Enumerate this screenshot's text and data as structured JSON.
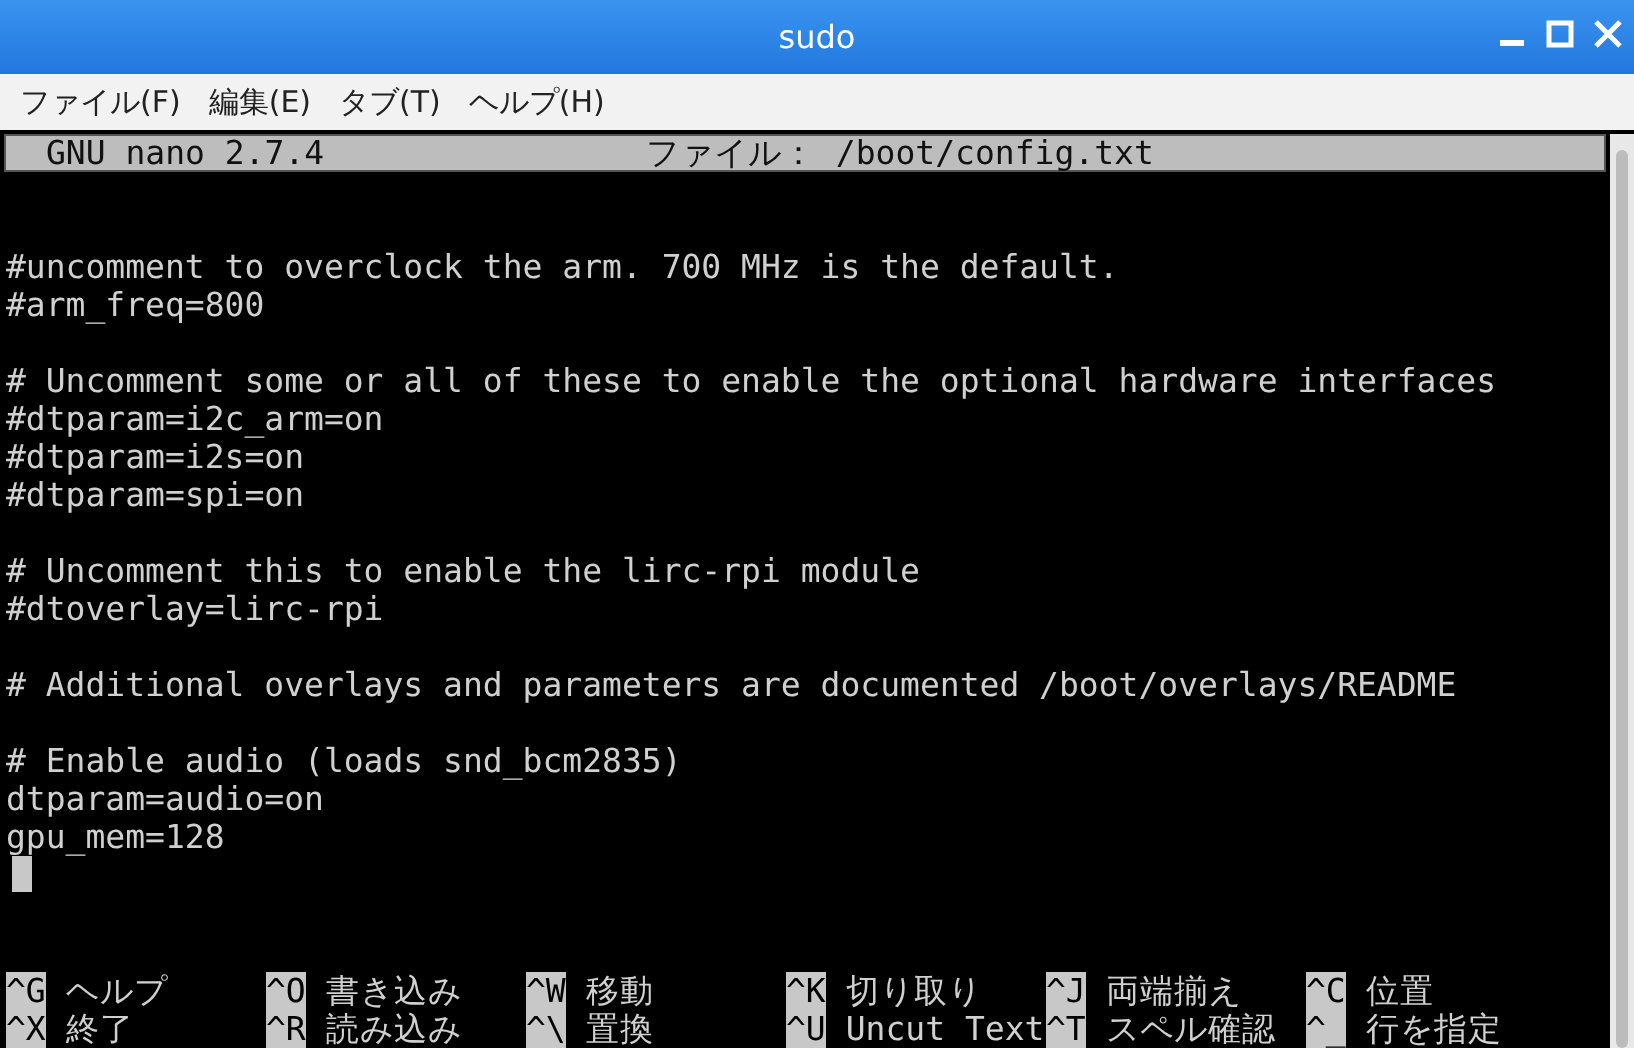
{
  "window": {
    "title": "sudo"
  },
  "menu": [
    "ファイル(F)",
    "編集(E)",
    "タブ(T)",
    "ヘルプ(H)"
  ],
  "nano_header": {
    "version": "GNU nano 2.7.4",
    "file": "ファイル： /boot/config.txt"
  },
  "blocks": [
    [
      "#uncomment to overclock the arm. 700 MHz is the default.",
      "#arm_freq=800"
    ],
    [
      "# Uncomment some or all of these to enable the optional hardware interfaces",
      "#dtparam=i2c_arm=on",
      "#dtparam=i2s=on",
      "#dtparam=spi=on"
    ],
    [
      "# Uncomment this to enable the lirc-rpi module",
      "#dtoverlay=lirc-rpi"
    ],
    [
      "# Additional overlays and parameters are documented /boot/overlays/README"
    ],
    [
      "# Enable audio (loads snd_bcm2835)",
      "dtparam=audio=on",
      "gpu_mem=128"
    ]
  ],
  "shortcuts": [
    [
      {
        "key": "^G",
        "label": "ヘルプ"
      },
      {
        "key": "^O",
        "label": "書き込み"
      },
      {
        "key": "^W",
        "label": "移動"
      },
      {
        "key": "^K",
        "label": "切り取り"
      },
      {
        "key": "^J",
        "label": "両端揃え"
      },
      {
        "key": "^C",
        "label": "位置"
      }
    ],
    [
      {
        "key": "^X",
        "label": "終了"
      },
      {
        "key": "^R",
        "label": "読み込み"
      },
      {
        "key": "^\\",
        "label": "置換"
      },
      {
        "key": "^U",
        "label": "Uncut Text"
      },
      {
        "key": "^T",
        "label": "スペル確認"
      },
      {
        "key": "^_",
        "label": "行を指定"
      }
    ]
  ]
}
